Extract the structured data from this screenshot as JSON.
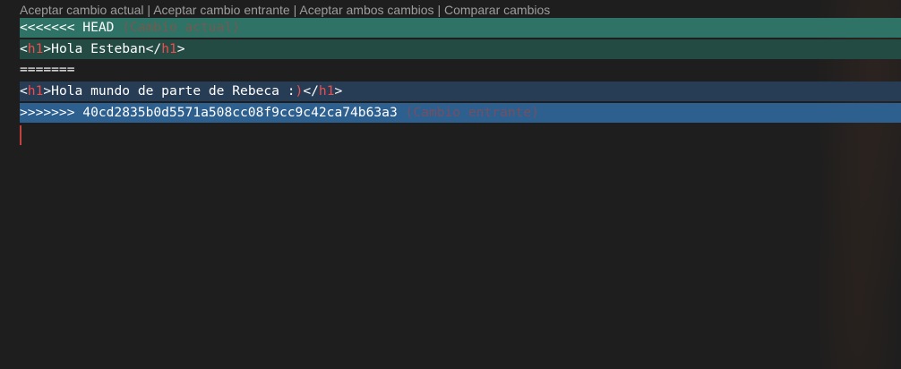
{
  "codelens": {
    "accept_current": "Aceptar cambio actual",
    "accept_incoming": "Aceptar cambio entrante",
    "accept_both": "Aceptar ambos cambios",
    "compare": "Comparar cambios",
    "separator": " | "
  },
  "lines": {
    "current_marker": "<<<<<<< HEAD",
    "current_hint": "(Cambio actual)",
    "current_open_lt": "<",
    "current_open_tag": "h1",
    "current_open_gt": ">",
    "current_text": "Hola Esteban",
    "current_close_lt": "</",
    "current_close_tag": "h1",
    "current_close_gt": ">",
    "separator_marker": "=======",
    "incoming_open_lt": "<",
    "incoming_open_tag": "h1",
    "incoming_open_gt": ">",
    "incoming_text": "Hola mundo de parte de Rebeca :",
    "incoming_paren": ")",
    "incoming_close_lt": "</",
    "incoming_close_tag": "h1",
    "incoming_close_gt": ">",
    "incoming_marker": ">>>>>>> 40cd2835b0d5571a508cc08f9cc9c42ca74b63a3",
    "incoming_hint": "(Cambio entrante)"
  },
  "colors": {
    "current_header_bg": "#2f7366",
    "current_body_bg": "#244a44",
    "incoming_body_bg": "#273c55",
    "incoming_header_bg": "#2d5f8f",
    "tag": "#f14c4c",
    "editor_bg": "#1e1e1e"
  }
}
